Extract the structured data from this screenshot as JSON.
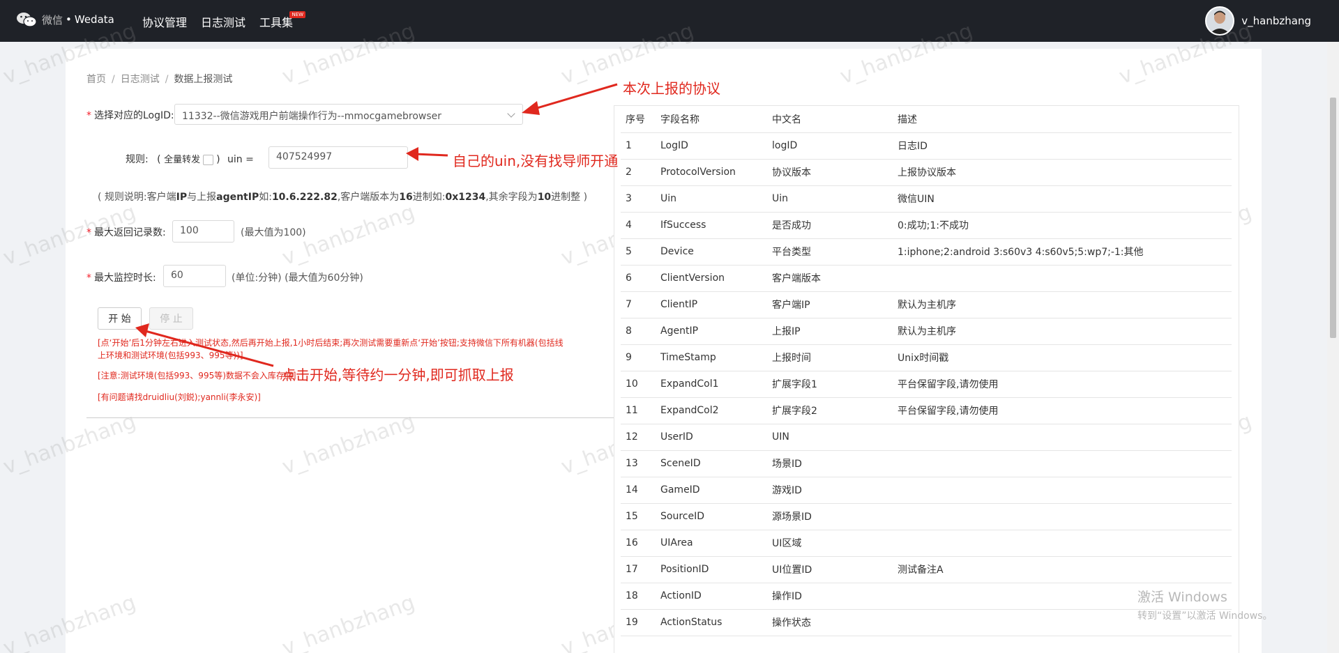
{
  "brand": {
    "name": "微信",
    "dot": "•",
    "product": "Wedata"
  },
  "nav": [
    {
      "label": "协议管理"
    },
    {
      "label": "日志测试"
    },
    {
      "label": "工具集",
      "badge": "NEW"
    }
  ],
  "user": {
    "name": "v_hanbzhang"
  },
  "breadcrumb": {
    "home": "首页",
    "parent": "日志测试",
    "current": "数据上报测试",
    "sep": "/"
  },
  "form": {
    "logid_label": "选择对应的LogID:",
    "logid_value": "11332--微信游戏用户前端操作行为--mmocgamebrowser",
    "rule_label": "规则:",
    "rule_open": "(",
    "rule_all_forward": "全量转发",
    "rule_close": ")",
    "uin_label": "uin =",
    "uin_value": "407524997",
    "rule_note_prefix": "( 规则说明:客户端",
    "rule_note_ip": "IP",
    "rule_note_mid": "与上报",
    "rule_note_agentip": "agentIP",
    "rule_note_ex1": "如:",
    "rule_note_ipval": "10.6.222.82",
    "rule_note_ver": ",客户端版本为",
    "rule_note_16": "16",
    "rule_note_hex": "进制如:",
    "rule_note_hexval": "0x1234",
    "rule_note_rest": ",其余字段为",
    "rule_note_10": "10",
    "rule_note_end": "进制整 )",
    "max_records_label": "最大返回记录数:",
    "max_records_value": "100",
    "max_records_hint": "(最大值为100)",
    "max_time_label": "最大监控时长:",
    "max_time_value": "60",
    "max_time_hint": "(单位:分钟)  (最大值为60分钟)",
    "start_button": "开 始",
    "stop_button": "停 止",
    "warn1": "[点‘开始’后1分钟左右进入测试状态,然后再开始上报,1小时后结束;再次测试需要重新点‘开始’按钮;支持微信下所有机器(包括线",
    "warn1b": "上环境和测试环境(包括993、995等))]",
    "warn2": "[注意:测试环境(包括993、995等)数据不会入库存储]",
    "warn3": "[有问题请找druidliu(刘鋭);yannli(李永安)]"
  },
  "table": {
    "headers": [
      "序号",
      "字段名称",
      "中文名",
      "描述"
    ],
    "rows": [
      [
        "1",
        "LogID",
        "logID",
        "日志ID"
      ],
      [
        "2",
        "ProtocolVersion",
        "协议版本",
        "上报协议版本"
      ],
      [
        "3",
        "Uin",
        "Uin",
        "微信UIN"
      ],
      [
        "4",
        "IfSuccess",
        "是否成功",
        "0:成功;1:不成功"
      ],
      [
        "5",
        "Device",
        "平台类型",
        "1:iphone;2:android 3:s60v3 4:s60v5;5:wp7;-1:其他"
      ],
      [
        "6",
        "ClientVersion",
        "客户端版本",
        ""
      ],
      [
        "7",
        "ClientIP",
        "客户端IP",
        "默认为主机序"
      ],
      [
        "8",
        "AgentIP",
        "上报IP",
        "默认为主机序"
      ],
      [
        "9",
        "TimeStamp",
        "上报时间",
        "Unix时间戳"
      ],
      [
        "10",
        "ExpandCol1",
        "扩展字段1",
        "平台保留字段,请勿使用"
      ],
      [
        "11",
        "ExpandCol2",
        "扩展字段2",
        "平台保留字段,请勿使用"
      ],
      [
        "12",
        "UserID",
        "UIN",
        ""
      ],
      [
        "13",
        "SceneID",
        "场景ID",
        ""
      ],
      [
        "14",
        "GameID",
        "游戏ID",
        ""
      ],
      [
        "15",
        "SourceID",
        "源场景ID",
        ""
      ],
      [
        "16",
        "UIArea",
        "UI区域",
        ""
      ],
      [
        "17",
        "PositionID",
        "UI位置ID",
        "测试备注A"
      ],
      [
        "18",
        "ActionID",
        "操作ID",
        ""
      ],
      [
        "19",
        "ActionStatus",
        "操作状态",
        ""
      ]
    ]
  },
  "annotations": {
    "a1": "本次上报的协议",
    "a2": "自己的uin,没有找导师开通",
    "a3": "点击开始,等待约一分钟,即可抓取上报"
  },
  "watermark": "v_hanbzhang",
  "activation": {
    "line1": "激活 Windows",
    "line2": "转到“设置”以激活 Windows。"
  },
  "colors": {
    "topbar": "#1f2228",
    "accent_red": "#e0281e",
    "background": "#f0f2f5"
  }
}
